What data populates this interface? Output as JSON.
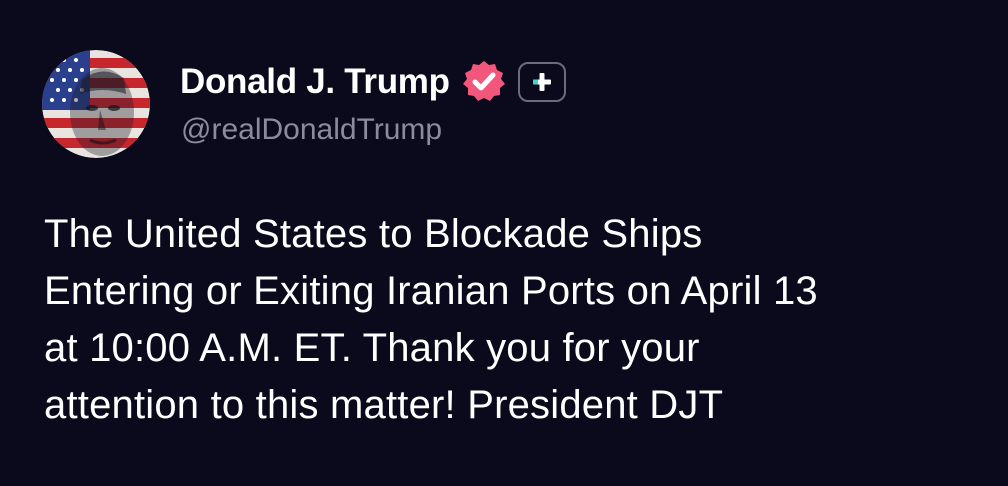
{
  "author": {
    "display_name": "Donald J. Trump",
    "handle": "@realDonaldTrump",
    "avatar_icon": "flag-portrait-avatar",
    "verified_icon": "verified-badge-icon",
    "verified_color": "#f2577b",
    "follow_icon": "plus-icon",
    "follow_accent": "#3fd8c7"
  },
  "post": {
    "text": "The United States to Blockade Ships\nEntering or Exiting Iranian Ports on April 13\nat 10:00 A.M. ET. Thank you for your\nattention to this matter! President DJT"
  },
  "theme": {
    "background": "#0b0a1c",
    "text_color": "#ffffff",
    "handle_color": "#8b8b9c"
  }
}
